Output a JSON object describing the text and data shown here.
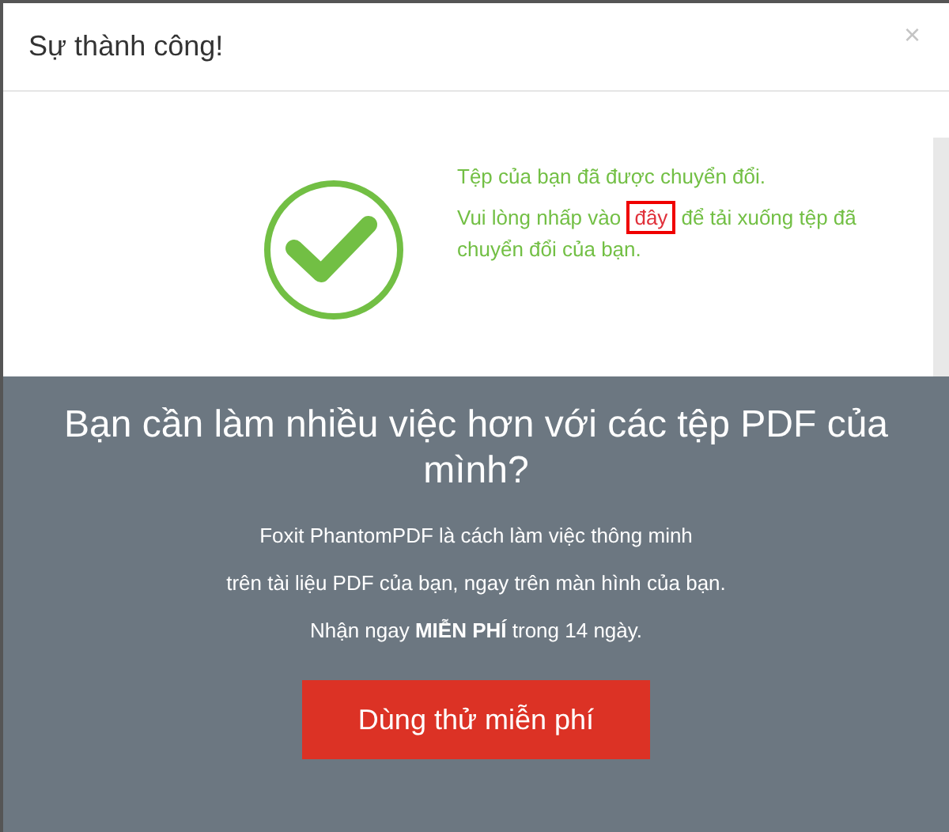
{
  "dialog": {
    "title": "Sự thành công!",
    "close": "×"
  },
  "message": {
    "line_1": "Tệp của bạn đã được chuyển đổi.",
    "line_2_before": "Vui lòng nhấp vào ",
    "link": {
      "text": "đây",
      "highlighted": true
    },
    "line_2_after": " để tải xuống tệp đã chuyển đổi của bạn."
  },
  "promo": {
    "heading": "Bạn cần làm nhiều việc hơn với các tệp PDF của mình?",
    "lines": [
      "Foxit PhantomPDF là cách làm việc thông minh",
      "trên tài liệu PDF của bạn, ngay trên màn hình của bạn.",
      "Nhận ngay **MIỄN PHÍ** trong 14 ngày."
    ],
    "button": "Dùng thử miễn phí"
  }
}
